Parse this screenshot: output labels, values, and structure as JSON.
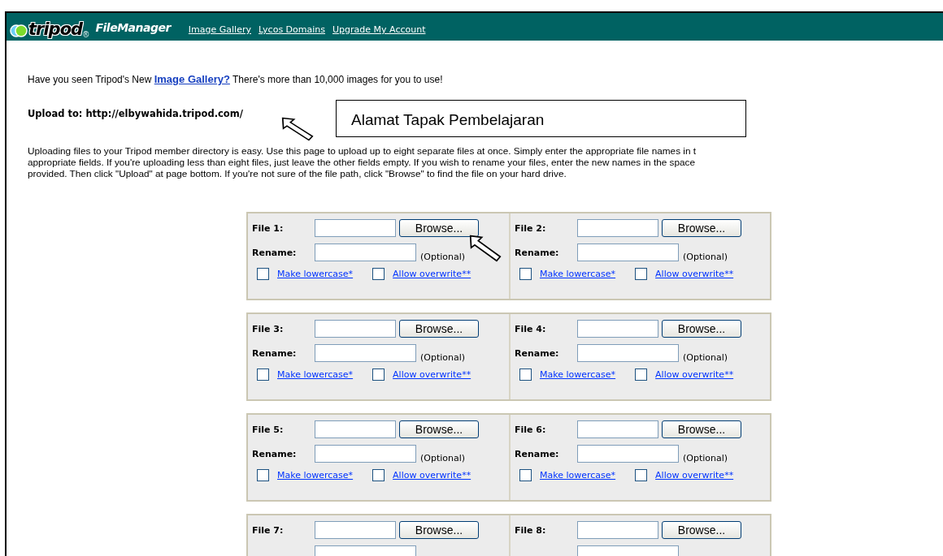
{
  "header": {
    "logo_text": "tripod",
    "registered": "®",
    "app_name": "FileManager",
    "links": [
      "Image Gallery",
      "Lycos Domains",
      "Upgrade My Account"
    ]
  },
  "intro": {
    "before": "Have you seen Tripod's New ",
    "link": "Image Gallery?",
    "after": " There's more than 10,000 images for you to use!"
  },
  "upload_to": "Upload to: http://elbywahida.tripod.com/",
  "instructions": [
    "Uploading files to your Tripod member directory is easy. Use this page to upload up to eight separate files at once. Simply enter the appropriate file names in t",
    "appropriate fields. If you're uploading less than eight files, just leave the other fields empty. If you wish to rename your files, enter the new names in the space",
    "provided. Then click \"Upload\" at page bottom. If you're not sure of the file path, click \"Browse\" to find the file on your hard drive."
  ],
  "slots": [
    {
      "file_label": "File 1:",
      "browse": "Browse...",
      "rename_label": "Rename:",
      "optional": "(Optional)",
      "lowercase": {
        "label": "Make lowercase*",
        "checked": false
      },
      "overwrite": {
        "label": "Allow overwrite**",
        "checked": false
      }
    },
    {
      "file_label": "File 2:",
      "browse": "Browse...",
      "rename_label": "Rename:",
      "optional": "(Optional)",
      "lowercase": {
        "label": "Make lowercase*",
        "checked": false
      },
      "overwrite": {
        "label": "Allow overwrite**",
        "checked": false
      }
    },
    {
      "file_label": "File 3:",
      "browse": "Browse...",
      "rename_label": "Rename:",
      "optional": "(Optional)",
      "lowercase": {
        "label": "Make lowercase*",
        "checked": false
      },
      "overwrite": {
        "label": "Allow overwrite**",
        "checked": false
      }
    },
    {
      "file_label": "File 4:",
      "browse": "Browse...",
      "rename_label": "Rename:",
      "optional": "(Optional)",
      "lowercase": {
        "label": "Make lowercase*",
        "checked": false
      },
      "overwrite": {
        "label": "Allow overwrite**",
        "checked": false
      }
    },
    {
      "file_label": "File 5:",
      "browse": "Browse...",
      "rename_label": "Rename:",
      "optional": "(Optional)",
      "lowercase": {
        "label": "Make lowercase*",
        "checked": false
      },
      "overwrite": {
        "label": "Allow overwrite**",
        "checked": false
      }
    },
    {
      "file_label": "File 6:",
      "browse": "Browse...",
      "rename_label": "Rename:",
      "optional": "(Optional)",
      "lowercase": {
        "label": "Make lowercase*",
        "checked": false
      },
      "overwrite": {
        "label": "Allow overwrite**",
        "checked": false
      }
    },
    {
      "file_label": "File 7:",
      "browse": "Browse..."
    },
    {
      "file_label": "File 8:",
      "browse": "Browse..."
    }
  ],
  "callout": {
    "text": "Alamat Tapak Pembelajaran"
  }
}
